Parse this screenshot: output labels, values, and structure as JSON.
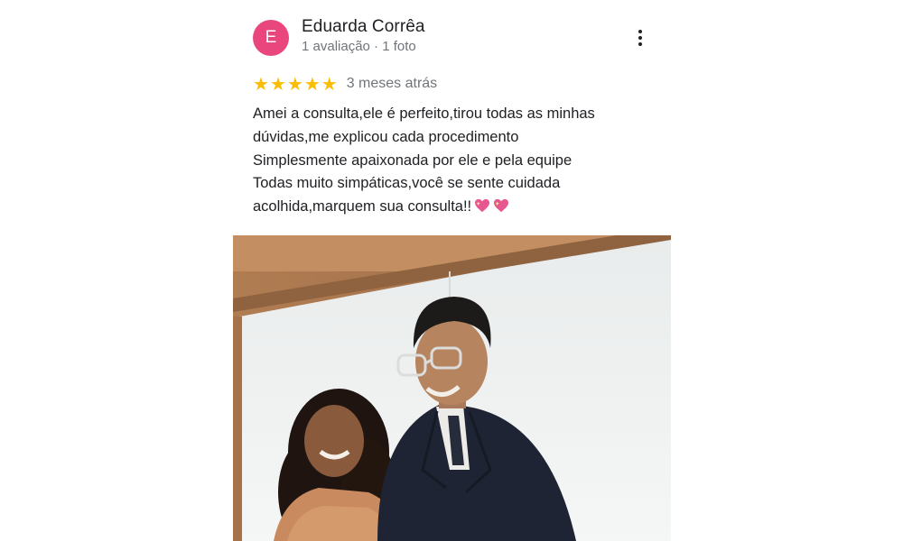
{
  "author": {
    "initial": "E",
    "name": "Eduarda Corrêa",
    "meta": "1 avaliação · 1 foto",
    "avatar_color": "#e8467c"
  },
  "menu": {
    "icon": "more-vert-icon"
  },
  "rating": {
    "stars": 5,
    "max": 5,
    "star_color": "#fbbc04",
    "date": "3 meses atrás"
  },
  "review": {
    "lines": [
      "Amei a consulta,ele é perfeito,tirou todas as minhas",
      "dúvidas,me explicou cada procedimento",
      "Simplesmente apaixonada por ele e pela equipe",
      "Todas muito simpáticas,você se sente cuidada",
      "acolhida,marquem sua consulta!!"
    ],
    "emojis": [
      "sparkling-heart-icon",
      "sparkling-heart-icon"
    ]
  },
  "photo": {
    "description_icon": "review-photo"
  }
}
